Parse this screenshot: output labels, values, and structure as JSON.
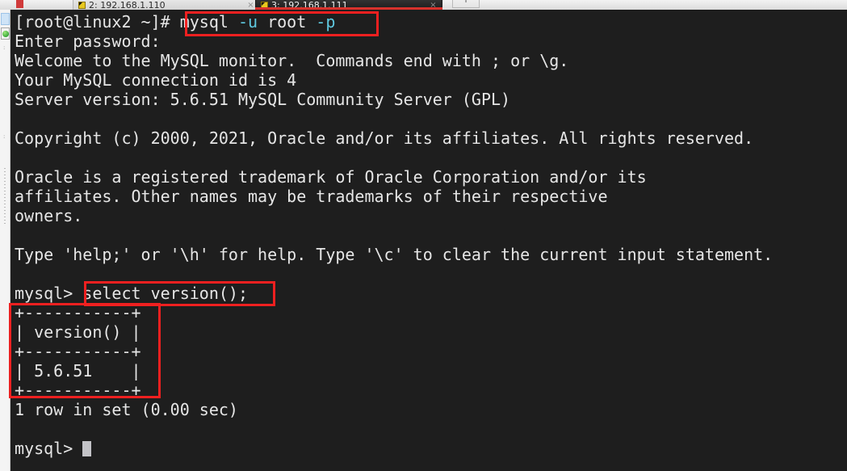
{
  "window": {
    "tabs": [
      {
        "label": "2: 192.168.1.110",
        "active": false,
        "close": "×",
        "icon": "terminal-session-icon"
      },
      {
        "label": "3: 192.168.1.111",
        "active": true,
        "close": "×",
        "icon": "terminal-session-icon"
      }
    ],
    "new_tab_label": "+"
  },
  "colors": {
    "terminal_background": "#1e1e1e",
    "terminal_foreground": "#e6e6e6",
    "annotation_red": "#ef2020",
    "option_cyan": "#5fc9e0",
    "cursor": "#c3c3c7"
  },
  "terminal": {
    "lines": [
      {
        "id": "line-prompt-mysql-login",
        "segments": [
          {
            "text": "[root@linux2 ~]# ",
            "color": "white"
          },
          {
            "text": "mysql ",
            "color": "white"
          },
          {
            "text": "-u",
            "color": "cyan"
          },
          {
            "text": " root ",
            "color": "white"
          },
          {
            "text": "-p",
            "color": "cyan"
          }
        ]
      },
      {
        "id": "line-enter-password",
        "segments": [
          {
            "text": "Enter password:",
            "color": "white"
          }
        ]
      },
      {
        "id": "line-welcome",
        "segments": [
          {
            "text": "Welcome to the MySQL monitor.  Commands end with ; or \\g.",
            "color": "white"
          }
        ]
      },
      {
        "id": "line-connection-id",
        "segments": [
          {
            "text": "Your MySQL connection id is 4",
            "color": "white"
          }
        ]
      },
      {
        "id": "line-server-version",
        "segments": [
          {
            "text": "Server version: 5.6.51 MySQL Community Server (GPL)",
            "color": "white"
          }
        ]
      },
      {
        "id": "line-blank-1",
        "segments": [
          {
            "text": "",
            "color": "white"
          }
        ]
      },
      {
        "id": "line-copyright",
        "segments": [
          {
            "text": "Copyright (c) 2000, 2021, Oracle and/or its affiliates. All rights reserved.",
            "color": "white"
          }
        ]
      },
      {
        "id": "line-blank-2",
        "segments": [
          {
            "text": "",
            "color": "white"
          }
        ]
      },
      {
        "id": "line-trademark-1",
        "segments": [
          {
            "text": "Oracle is a registered trademark of Oracle Corporation and/or its",
            "color": "white"
          }
        ]
      },
      {
        "id": "line-trademark-2",
        "segments": [
          {
            "text": "affiliates. Other names may be trademarks of their respective",
            "color": "white"
          }
        ]
      },
      {
        "id": "line-trademark-3",
        "segments": [
          {
            "text": "owners.",
            "color": "white"
          }
        ]
      },
      {
        "id": "line-blank-3",
        "segments": [
          {
            "text": "",
            "color": "white"
          }
        ]
      },
      {
        "id": "line-help-hint",
        "segments": [
          {
            "text": "Type 'help;' or '\\h' for help. Type '\\c' to clear the current input statement.",
            "color": "white"
          }
        ]
      },
      {
        "id": "line-blank-4",
        "segments": [
          {
            "text": "",
            "color": "white"
          }
        ]
      },
      {
        "id": "line-query-select-version",
        "segments": [
          {
            "text": "mysql> ",
            "color": "white"
          },
          {
            "text": "select version();",
            "color": "white"
          }
        ]
      },
      {
        "id": "line-table-top-border",
        "segments": [
          {
            "text": "+-----------+",
            "color": "white"
          }
        ]
      },
      {
        "id": "line-table-header",
        "segments": [
          {
            "text": "| version() |",
            "color": "white"
          }
        ]
      },
      {
        "id": "line-table-mid-border",
        "segments": [
          {
            "text": "+-----------+",
            "color": "white"
          }
        ]
      },
      {
        "id": "line-table-row-1",
        "segments": [
          {
            "text": "| 5.6.51    |",
            "color": "white"
          }
        ]
      },
      {
        "id": "line-table-bottom-border",
        "segments": [
          {
            "text": "+-----------+",
            "color": "white"
          }
        ]
      },
      {
        "id": "line-row-count",
        "segments": [
          {
            "text": "1 row in set (0.00 sec)",
            "color": "white"
          }
        ]
      },
      {
        "id": "line-blank-5",
        "segments": [
          {
            "text": "",
            "color": "white"
          }
        ]
      },
      {
        "id": "line-final-prompt",
        "cursor": true,
        "segments": [
          {
            "text": "mysql> ",
            "color": "white"
          }
        ]
      }
    ]
  },
  "query_result": {
    "command": "select version();",
    "columns": [
      "version()"
    ],
    "rows": [
      [
        "5.6.51"
      ]
    ],
    "status": "1 row in set (0.00 sec)"
  },
  "annotations": [
    {
      "name": "annotation-login-command",
      "target": "mysql -u root -p"
    },
    {
      "name": "annotation-select-version-query",
      "target": "select version();"
    },
    {
      "name": "annotation-version-result-table",
      "target": "+-----------+ version() 5.6.51"
    }
  ]
}
